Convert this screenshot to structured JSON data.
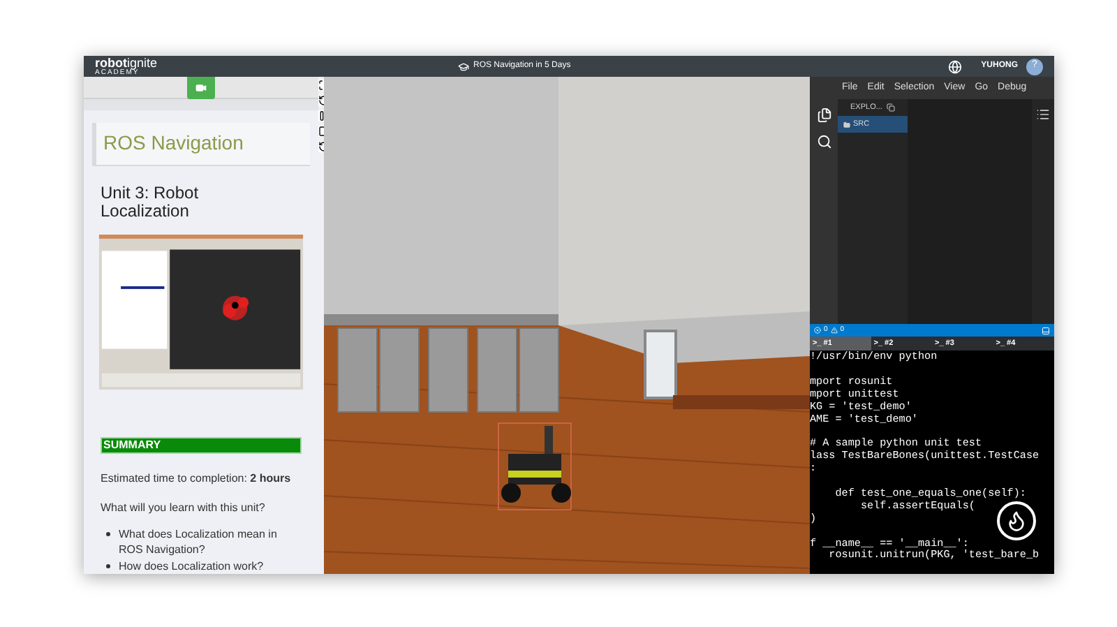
{
  "top_bar": {
    "logo": "**robot**ignite",
    "logo_tagline": "ACADEMY",
    "title": "ROS Navigation in 5 Days",
    "user": "YUHONG",
    "help": "?"
  },
  "notebook": {
    "course_title": "ROS Navigation",
    "unit_title": "Unit 3: Robot Localization",
    "summary_heading": "SUMMARY",
    "estimate": "Estimated time to completion: **2 hours**",
    "question": "What will you learn with this unit?",
    "bullets": [
      "What does Localization mean in ROS Navigation?",
      "How does Localization work?"
    ]
  },
  "editor": {
    "menu": [
      "File",
      "Edit",
      "Selection",
      "View",
      "Go",
      "Debug"
    ],
    "explorer_title": "EXPLO...",
    "tree": [
      {
        "label": "SRC",
        "selected": true
      }
    ],
    "errors": "0",
    "warnings": "0"
  },
  "terminal": {
    "tabs": [
      {
        "label": ">_ #1",
        "selected": true
      },
      {
        "label": ">_ #2",
        "selected": false
      },
      {
        "label": ">_ #3",
        "selected": false
      },
      {
        "label": ">_ #4",
        "selected": false
      }
    ],
    "code": "!/usr/bin/env python\n\nmport rosunit\nmport unittest\nKG = 'test_demo'\nAME = 'test_demo'\n\n# A sample python unit test\nlass TestBareBones(unittest.TestCase\n:\n\n    def test_one_equals_one(self):\n        self.assertEquals(\n)\n\nf __name__ == '__main__':\n   rosunit.unitrun(PKG, 'test_bare_b"
  }
}
